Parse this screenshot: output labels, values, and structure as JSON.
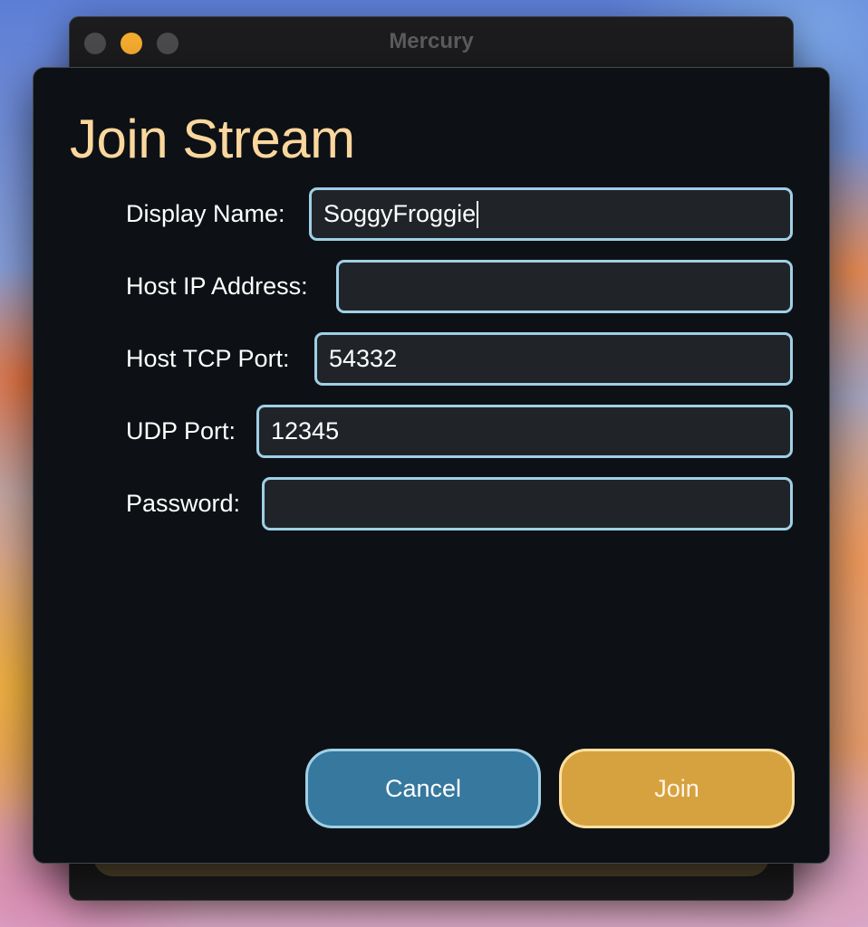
{
  "window": {
    "title": "Mercury",
    "traffic_lights": {
      "close_icon": "close-dot-icon",
      "minimize_icon": "minimize-dot-icon",
      "zoom_icon": "zoom-dot-icon",
      "minimize_color": "#f5ac2f"
    }
  },
  "dialog": {
    "title": "Join Stream",
    "fields": {
      "display_name": {
        "label": "Display Name:",
        "value": "SoggyFroggie"
      },
      "host_ip": {
        "label": "Host IP Address:",
        "value": ""
      },
      "host_tcp_port": {
        "label": "Host TCP Port:",
        "value": "54332"
      },
      "udp_port": {
        "label": "UDP Port:",
        "value": "12345"
      },
      "password": {
        "label": "Password:",
        "value": ""
      }
    },
    "buttons": {
      "cancel": "Cancel",
      "join": "Join"
    }
  },
  "colors": {
    "title": "#fbd79e",
    "field_border": "#9fd0e6",
    "cancel_bg": "#36789e",
    "join_bg": "#d6a240"
  }
}
